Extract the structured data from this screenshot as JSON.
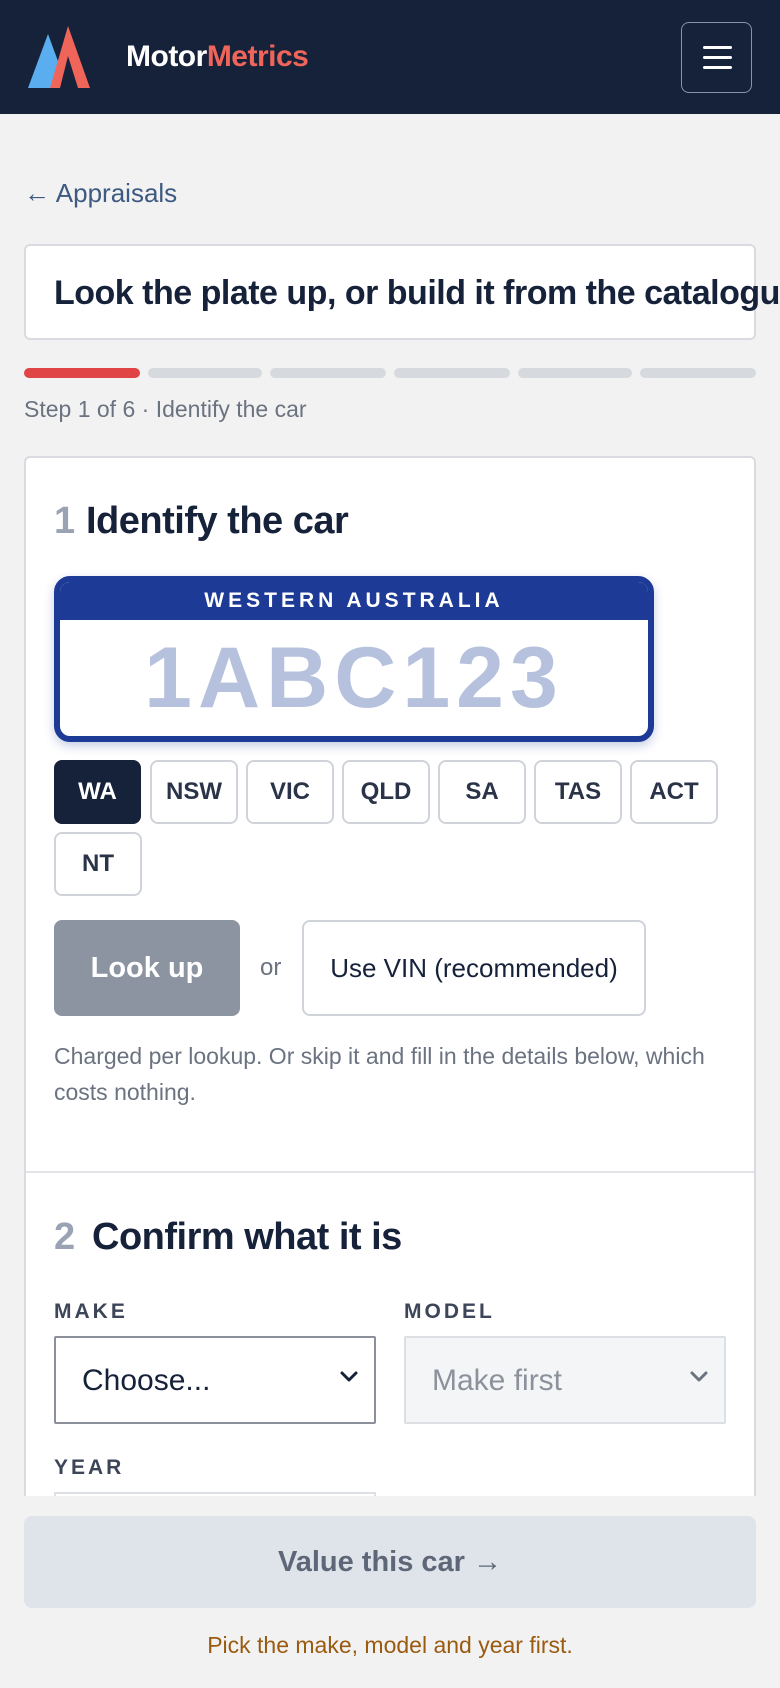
{
  "header": {
    "brand_part1": "Motor",
    "brand_part2": "Metrics",
    "colors": {
      "background": "#16213a",
      "brand_accent": "#f0655a",
      "logo_blue": "#5aaef0"
    },
    "menu_icon": "hamburger-icon"
  },
  "nav": {
    "back_link": "← Appraisals"
  },
  "title": "Look the plate up, or build it from the catalogue",
  "progress": {
    "total_steps": 6,
    "current_step": 1,
    "label": "Step 1 of 6 · Identify the car"
  },
  "section1": {
    "number": "1",
    "title": "Identify the car",
    "plate": {
      "state_name": "WESTERN AUSTRALIA",
      "placeholder": "1ABC123",
      "value": ""
    },
    "states": [
      "WA",
      "NSW",
      "VIC",
      "QLD",
      "SA",
      "TAS",
      "ACT",
      "NT"
    ],
    "selected_state": "WA",
    "lookup_label": "Look up",
    "or_label": "or",
    "vin_label": "Use VIN (recommended)",
    "help_text": "Charged per lookup. Or skip it and fill in the details below, which costs nothing."
  },
  "section2": {
    "number": "2",
    "title": "Confirm what it is",
    "make": {
      "label": "MAKE",
      "value": "Choose..."
    },
    "model": {
      "label": "MODEL",
      "value": "Make first",
      "disabled": true
    },
    "year": {
      "label": "YEAR"
    }
  },
  "footer": {
    "value_button": "Value this car →",
    "hint": "Pick the make, model and year first.",
    "colors": {
      "hint": "#9a5b10",
      "active_progress": "#e04444"
    }
  }
}
